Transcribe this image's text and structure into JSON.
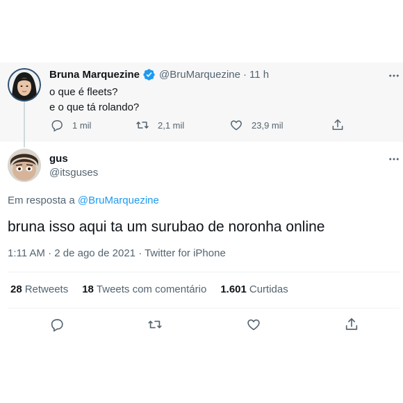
{
  "parent": {
    "name": "Bruna Marquezine",
    "handle": "@BruMarquezine",
    "separator": "·",
    "time": "11 h",
    "lines": [
      "o que é fleets?",
      "e o que tá rolando?"
    ],
    "replies": "1 mil",
    "retweets": "2,1 mil",
    "likes": "23,9 mil"
  },
  "reply": {
    "name": "gus",
    "handle": "@itsguses",
    "reply_prefix": "Em resposta a",
    "reply_mention": "@BruMarquezine",
    "text": "bruna isso aqui ta um surubao de noronha online",
    "meta": "1:11 AM · 2 de ago de 2021 · Twitter for iPhone"
  },
  "stats": [
    {
      "count": "28",
      "label": "Retweets"
    },
    {
      "count": "18",
      "label": "Tweets com comentário"
    },
    {
      "count": "1.601",
      "label": "Curtidas"
    }
  ],
  "colors": {
    "accent": "#1d9bf0",
    "muted": "#536471",
    "parent_bg": "#f7f7f7"
  },
  "icons": [
    "verified-badge-icon",
    "more-options-icon",
    "reply-icon",
    "retweet-icon",
    "like-icon",
    "share-icon"
  ]
}
